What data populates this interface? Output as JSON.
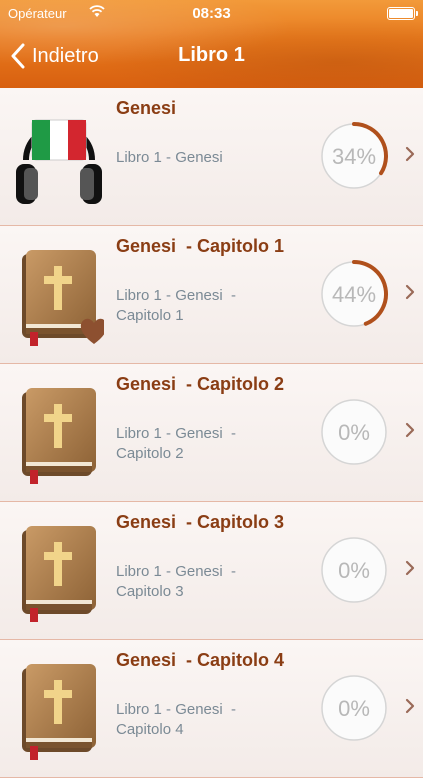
{
  "status": {
    "carrier": "Opérateur",
    "time": "08:33"
  },
  "nav": {
    "back_label": "Indietro",
    "title": "Libro 1"
  },
  "rows": [
    {
      "title": "Genesi",
      "subtitle": "Libro 1 - Genesi",
      "progress": 34,
      "progress_label": "34%",
      "thumb": "headphones-italy-flag-icon",
      "favorite": false
    },
    {
      "title": "Genesi  - Capitolo 1",
      "subtitle": "Libro 1 - Genesi  -\nCapitolo 1",
      "progress": 44,
      "progress_label": "44%",
      "thumb": "bible-book-icon",
      "favorite": true
    },
    {
      "title": "Genesi  - Capitolo 2",
      "subtitle": "Libro 1 - Genesi  -\nCapitolo 2",
      "progress": 0,
      "progress_label": "0%",
      "thumb": "bible-book-icon",
      "favorite": false
    },
    {
      "title": "Genesi  - Capitolo 3",
      "subtitle": "Libro 1 - Genesi  -\nCapitolo 3",
      "progress": 0,
      "progress_label": "0%",
      "thumb": "bible-book-icon",
      "favorite": false
    },
    {
      "title": "Genesi  - Capitolo 4",
      "subtitle": "Libro 1 - Genesi  -\nCapitolo 4",
      "progress": 0,
      "progress_label": "0%",
      "thumb": "bible-book-icon",
      "favorite": false
    }
  ],
  "colors": {
    "accent_arc": "#b0501c",
    "title": "#8a3d14",
    "subtitle": "#7b8a95"
  }
}
